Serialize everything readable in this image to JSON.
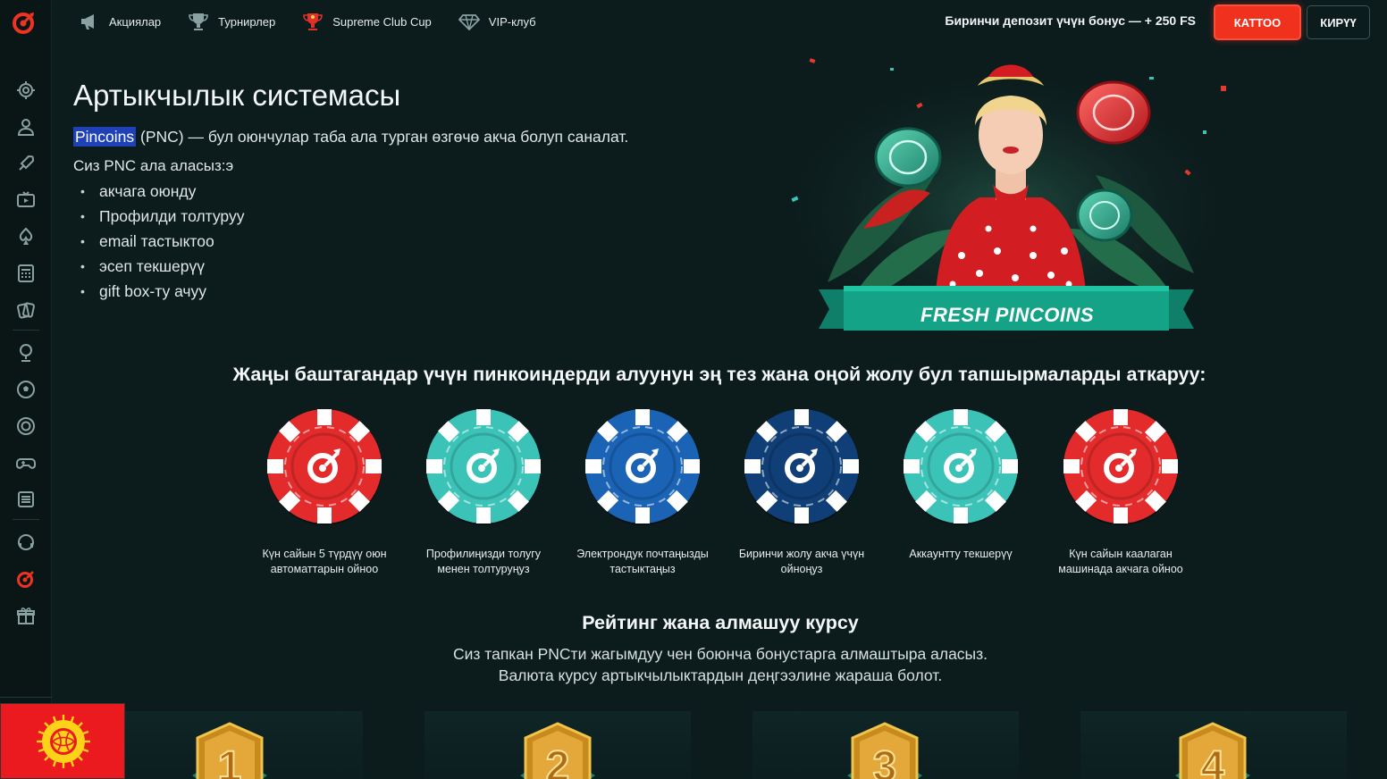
{
  "nav": {
    "items": [
      {
        "label": "Акциялар",
        "icon": "megaphone-icon"
      },
      {
        "label": "Турнирлер",
        "icon": "trophy-icon"
      },
      {
        "label": "Supreme Club Cup",
        "icon": "cup-icon"
      },
      {
        "label": "VIP-клуб",
        "icon": "diamond-icon"
      }
    ],
    "bonus_text": "Биринчи депозит үчүн бонус — + 250 FS",
    "register_label": "КАТТОО",
    "login_label": "КИРҮҮ"
  },
  "sidebar": {
    "icons": [
      "gear-icon",
      "user-icon",
      "rocket-icon",
      "tv-icon",
      "poker-icon",
      "calculator-icon",
      "cards-icon",
      "trophy-small-icon",
      "football-icon",
      "target-icon",
      "gamepad-icon",
      "news-icon",
      "support-icon",
      "pincoins-logo-icon",
      "gift-icon"
    ]
  },
  "hero": {
    "title": "Артыкчылык системасы",
    "intro_highlight": "Pincoins",
    "intro_rest": " (PNC) — бул оюнчулар таба ала турган өзгөчө акча болуп саналат.",
    "can_get": "Сиз PNC ала аласыз:э",
    "ways": [
      "акчага оюнду",
      "Профилди толтуруу",
      "email тастыктоо",
      "эсеп текшерүү",
      "gift box-ту ачуу"
    ],
    "promo_banner": "FRESH PINCOINS"
  },
  "tasks": {
    "heading": "Жаңы баштагандар үчүн пинкоиндерди алуунун эң тез жана оңой жолу бул тапшырмаларды аткаруу:",
    "items": [
      {
        "label": "Күн сайын 5 түрдүү оюн автоматтарын ойноо",
        "color": "#e32b2b"
      },
      {
        "label": "Профилиңизди толугу менен толтуруңуз",
        "color": "#3cc3b8"
      },
      {
        "label": "Электрондук почтаңызды тастыктаңыз",
        "color": "#1b63b5"
      },
      {
        "label": "Биринчи жолу акча үчүн ойноңуз",
        "color": "#0f3f76"
      },
      {
        "label": "Аккаунтту текшерүү",
        "color": "#3cc3b8"
      },
      {
        "label": "Күн сайын каалаган машинада акчага ойноо",
        "color": "#e32b2b"
      }
    ]
  },
  "rating": {
    "heading": "Рейтинг жана алмашуу курсу",
    "desc_line1": "Сиз тапкан PNCти жагымдуу чен боюнча бонустарга алмаштыра аласыз.",
    "desc_line2": "Валюта курсу артыкчылыктардын деңгээлине жараша болот.",
    "levels": [
      "1",
      "2",
      "3",
      "4"
    ]
  },
  "colors": {
    "accent": "#f0311e",
    "background": "#0c1b1c",
    "teal": "#1aa88f"
  }
}
